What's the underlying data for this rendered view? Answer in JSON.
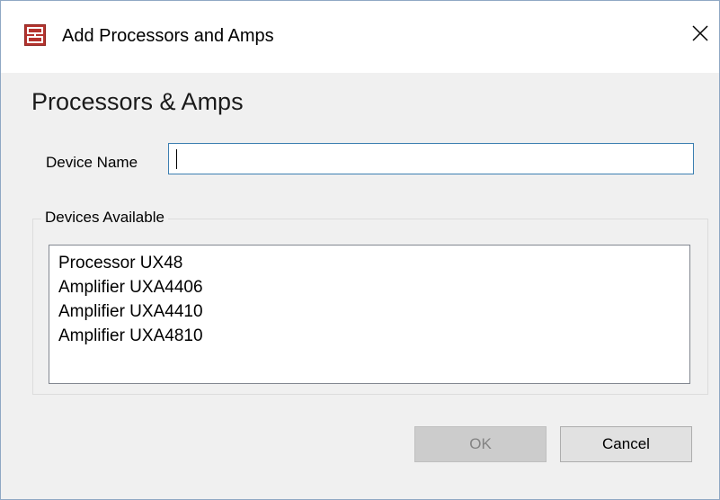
{
  "window": {
    "title": "Add Processors and Amps",
    "app_icon": "app-logo-icon",
    "close_icon": "close-icon"
  },
  "main": {
    "heading": "Processors & Amps",
    "device_name": {
      "label": "Device Name",
      "value": "",
      "placeholder": ""
    },
    "devices_available": {
      "label": "Devices Available",
      "items": [
        "Processor UX48",
        "Amplifier UXA4406",
        "Amplifier UXA4410",
        "Amplifier UXA4810"
      ]
    }
  },
  "buttons": {
    "ok_label": "OK",
    "ok_enabled": false,
    "cancel_label": "Cancel"
  },
  "colors": {
    "app_icon": "#b5332e",
    "input_focus_border": "#3c7fb1",
    "window_border": "#8fa8c4"
  }
}
